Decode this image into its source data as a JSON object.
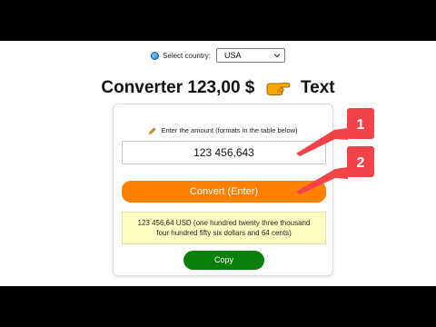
{
  "country": {
    "label": "Select country:",
    "selected": "USA",
    "globe_icon": "globe-icon"
  },
  "title": {
    "part1": "Converter 123,00 $",
    "part2": "Text",
    "hand_icon": "pointing-hand-icon"
  },
  "converter": {
    "amount_label": "Enter the amount (formats in the table below)",
    "amount_value": "123 456,643",
    "convert_label": "Convert (Enter)",
    "result_line1": "123 456,64 USD (one hundred twenty three thousand",
    "result_line2": "four hundred fifty six dollars and 64 cents)",
    "copy_label": "Copy"
  },
  "callouts": {
    "first": "1",
    "second": "2",
    "color": "#f2424a"
  },
  "colors": {
    "convert": "#ff7f00",
    "copy": "#0a7f0a",
    "result_bg": "#ffffc4"
  }
}
